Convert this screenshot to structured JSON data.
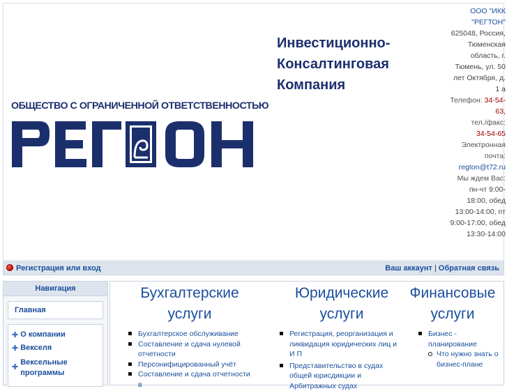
{
  "header": {
    "logo": {
      "caption": "ОБЩЕСТВО С ОГРАНИЧЕННОЙ ОТВЕТСТВЕННОСТЬЮ",
      "wordmark": "РЕГТОН",
      "color": "#1c2f6d"
    },
    "company_name": [
      "Инвестиционно-",
      "Консалтинговая",
      "Компания"
    ],
    "contacts": {
      "org_name": "ООО \"ИКК \"РЕГТОН\"",
      "address": "625048, Россия, Тюменская область, г. Тюмень, ул. 50 лет Октября, д. 1 а",
      "phone_label": "Телефон:",
      "phone": "34-54-63,",
      "fax_label": "тел./факс:",
      "fax": "34-54-65",
      "email_label": "Электронная почта:",
      "email": "regton@t72.ru",
      "hours_label": "Мы ждем Вас:",
      "hours": "пн-чт 9:00-18:00, обед 13:00-14:00, пт 9:00-17:00, обед 13:30-14:00"
    }
  },
  "loginbar": {
    "login_icon": "login-icon",
    "login_link": "Регистрация или вход",
    "account_link": "Ваш аккаунт",
    "separator": "|",
    "feedback_link": "Обратная связь"
  },
  "sidebar": {
    "title": "Навигация",
    "home": "Главная",
    "items": [
      {
        "label": "О компании",
        "icon": "plus-icon"
      },
      {
        "label": "Векселя",
        "icon": "plus-icon"
      },
      {
        "label": "Вексельные программы",
        "icon": "plus-icon"
      }
    ]
  },
  "main": {
    "columns": [
      {
        "title": "Бухгалтерские услуги",
        "items": [
          "Бухгалтерское обслуживание",
          "Составление и сдача нулевой отчетности",
          "Персонифицированный учёт",
          "Составление и сдача отчетности в"
        ]
      },
      {
        "title": "Юридические услуги",
        "items": [
          "Регистрация, реорганизация и ликвидация юридических лиц и И П",
          "Представительство в судах общей юрисдикции и Арбитражных судах"
        ]
      },
      {
        "title": "Финансовые услуги",
        "items": [
          "Бизнес - планирование"
        ],
        "subitems": [
          "Что нужно знать о бизнес-плане"
        ]
      }
    ]
  }
}
